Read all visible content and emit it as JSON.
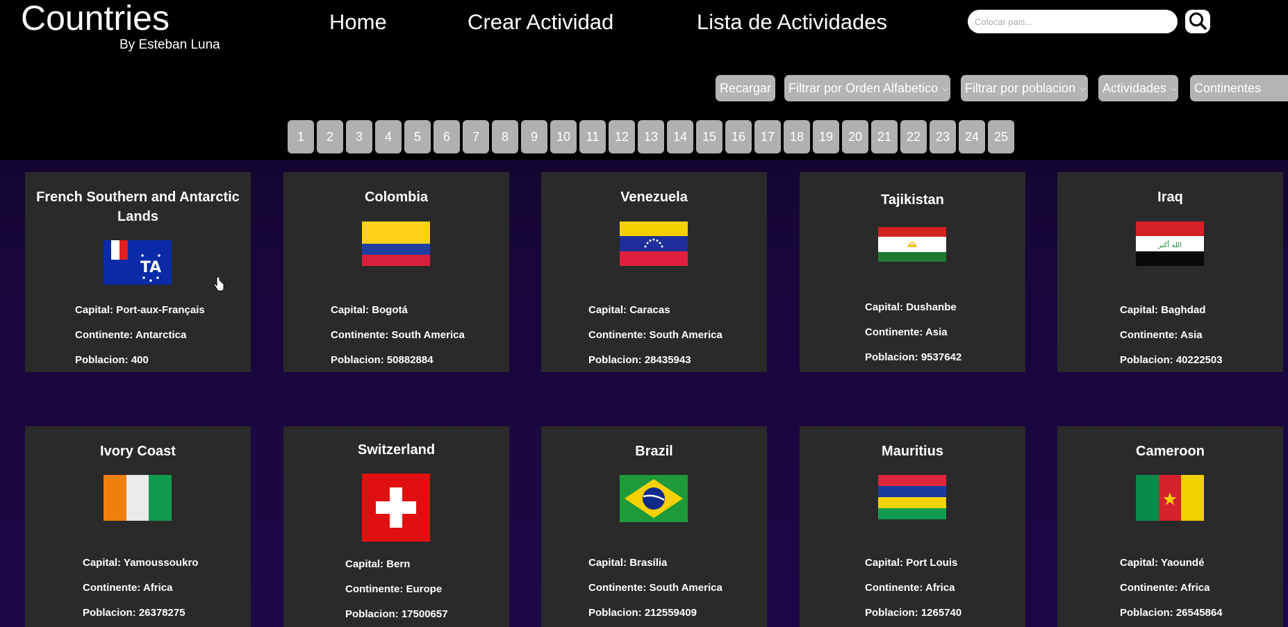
{
  "brand": {
    "title": "Countries",
    "subtitle": "By Esteban Luna"
  },
  "nav": {
    "home": "Home",
    "create": "Crear Actividad",
    "list": "Lista de Actividades"
  },
  "search": {
    "placeholder": "Colocar pais...",
    "value": "",
    "icon": "search-icon"
  },
  "filters": {
    "reload": "Recargar",
    "alpha": "Filtrar por Orden Alfabetico",
    "population": "Filtrar por poblacion",
    "activities": "Actividades",
    "continents": "Continentes"
  },
  "pages": [
    "1",
    "2",
    "3",
    "4",
    "5",
    "6",
    "7",
    "8",
    "9",
    "10",
    "11",
    "12",
    "13",
    "14",
    "15",
    "16",
    "17",
    "18",
    "19",
    "20",
    "21",
    "22",
    "23",
    "24",
    "25"
  ],
  "labels": {
    "capital": "Capital: ",
    "continent": "Continente: ",
    "population": "Poblacion: "
  },
  "countries": [
    {
      "name": "French Southern and Antarctic Lands",
      "capital": "Port-aux-Français",
      "continent": "Antarctica",
      "population": "400",
      "flag": "french-southern-lands-flag"
    },
    {
      "name": "Colombia",
      "capital": "Bogotá",
      "continent": "South America",
      "population": "50882884",
      "flag": "colombia-flag"
    },
    {
      "name": "Venezuela",
      "capital": "Caracas",
      "continent": "South America",
      "population": "28435943",
      "flag": "venezuela-flag"
    },
    {
      "name": "Tajikistan",
      "capital": "Dushanbe",
      "continent": "Asia",
      "population": "9537642",
      "flag": "tajikistan-flag"
    },
    {
      "name": "Iraq",
      "capital": "Baghdad",
      "continent": "Asia",
      "population": "40222503",
      "flag": "iraq-flag"
    },
    {
      "name": "Ivory Coast",
      "capital": "Yamoussoukro",
      "continent": "Africa",
      "population": "26378275",
      "flag": "ivory-coast-flag"
    },
    {
      "name": "Switzerland",
      "capital": "Bern",
      "continent": "Europe",
      "population": "17500657",
      "flag": "switzerland-flag"
    },
    {
      "name": "Brazil",
      "capital": "Brasília",
      "continent": "South America",
      "population": "212559409",
      "flag": "brazil-flag"
    },
    {
      "name": "Mauritius",
      "capital": "Port Louis",
      "continent": "Africa",
      "population": "1265740",
      "flag": "mauritius-flag"
    },
    {
      "name": "Cameroon",
      "capital": "Yaoundé",
      "continent": "Africa",
      "population": "26545864",
      "flag": "cameroon-flag"
    }
  ],
  "colors": {
    "header": "#000000",
    "card": "#2a2a2a",
    "button": "#b4b4b4",
    "background": "#1c0847"
  }
}
